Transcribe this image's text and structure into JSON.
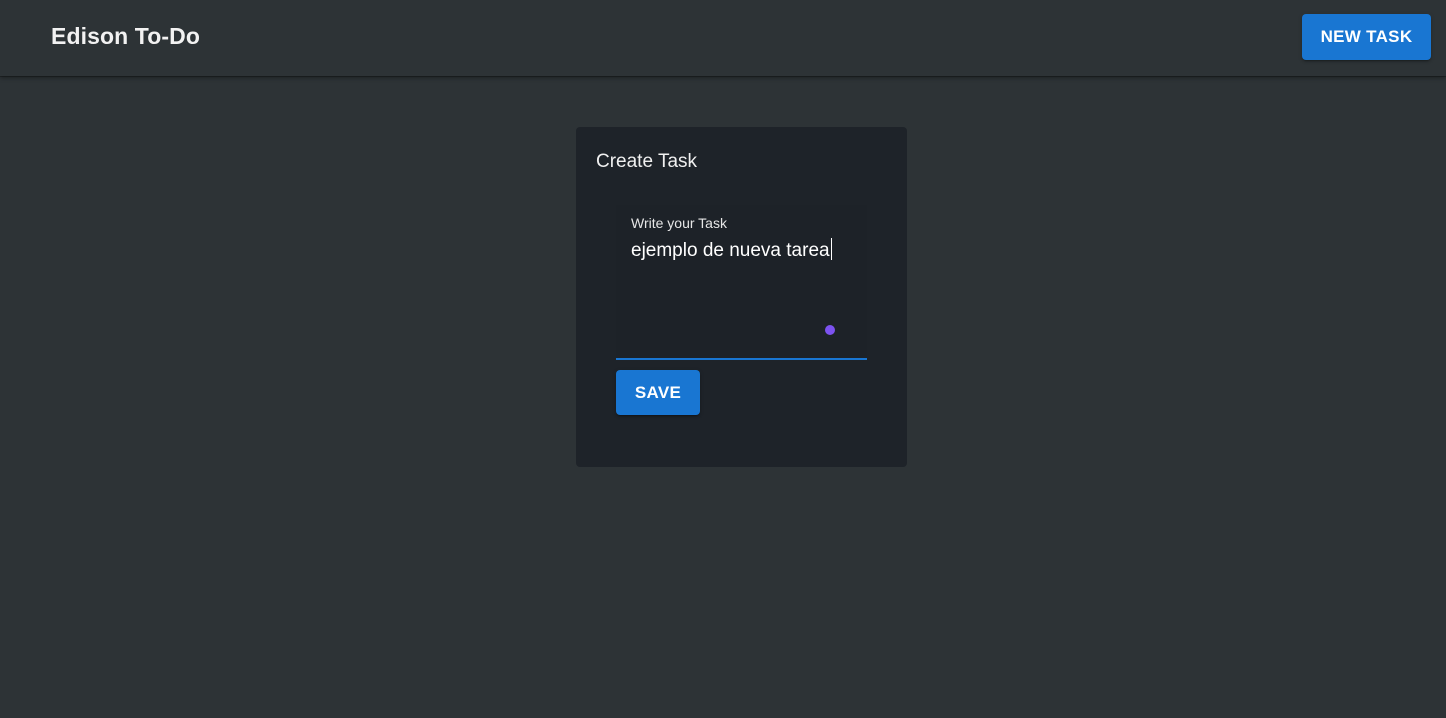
{
  "header": {
    "title": "Edison To-Do",
    "new_task_label": "NEW TASK"
  },
  "card": {
    "title": "Create Task",
    "field": {
      "label": "Write your Task",
      "value": "ejemplo de nueva tarea"
    },
    "save_label": "SAVE"
  },
  "colors": {
    "background": "#2d3336",
    "card": "#1e2329",
    "accent": "#1976d2",
    "resize_dot": "#7c52f0"
  },
  "icons": {
    "resize_handle": "resize-dot-icon"
  }
}
